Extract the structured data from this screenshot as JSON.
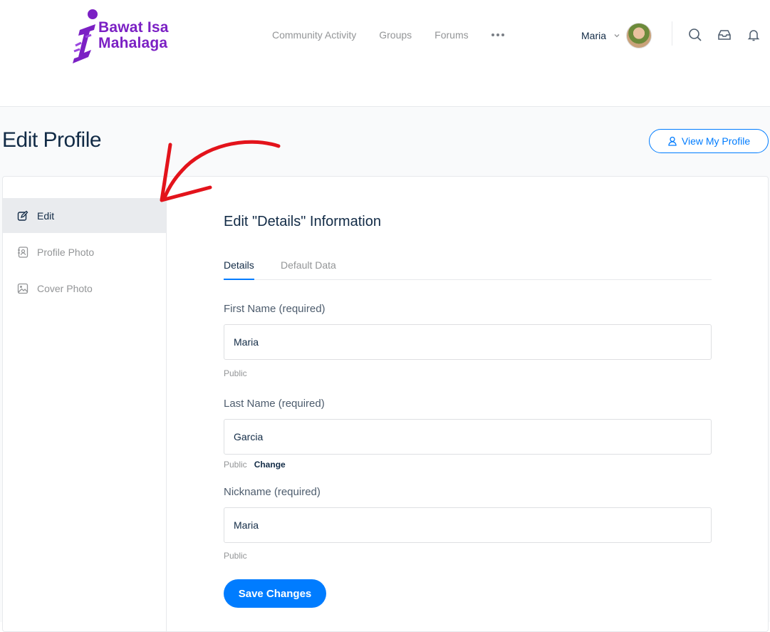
{
  "brand": {
    "line1": "Bawat Isa",
    "line2": "Mahalaga",
    "color": "#7b20c4"
  },
  "nav": {
    "items": [
      "Community Activity",
      "Groups",
      "Forums"
    ],
    "more_icon": "ellipsis-icon"
  },
  "user": {
    "name": "Maria"
  },
  "header_icons": [
    "search-icon",
    "inbox-icon",
    "bell-icon"
  ],
  "page": {
    "title": "Edit Profile",
    "view_profile_label": "View My Profile"
  },
  "sidebar": {
    "items": [
      {
        "label": "Edit",
        "icon": "edit-icon",
        "active": true
      },
      {
        "label": "Profile Photo",
        "icon": "contact-icon",
        "active": false
      },
      {
        "label": "Cover Photo",
        "icon": "image-icon",
        "active": false
      }
    ]
  },
  "form": {
    "title": "Edit \"Details\" Information",
    "tabs": [
      "Details",
      "Default Data"
    ],
    "fields": [
      {
        "label": "First Name (required)",
        "value": "Maria",
        "visibility": "Public",
        "action": ""
      },
      {
        "label": "Last Name (required)",
        "value": "Garcia",
        "visibility": "Public",
        "action": "Change"
      },
      {
        "label": "Nickname (required)",
        "value": "Maria",
        "visibility": "Public",
        "action": ""
      }
    ],
    "save_label": "Save Changes"
  },
  "colors": {
    "accent": "#007cff",
    "text": "#122b46",
    "muted": "#939597",
    "annotation": "#e3131b"
  }
}
